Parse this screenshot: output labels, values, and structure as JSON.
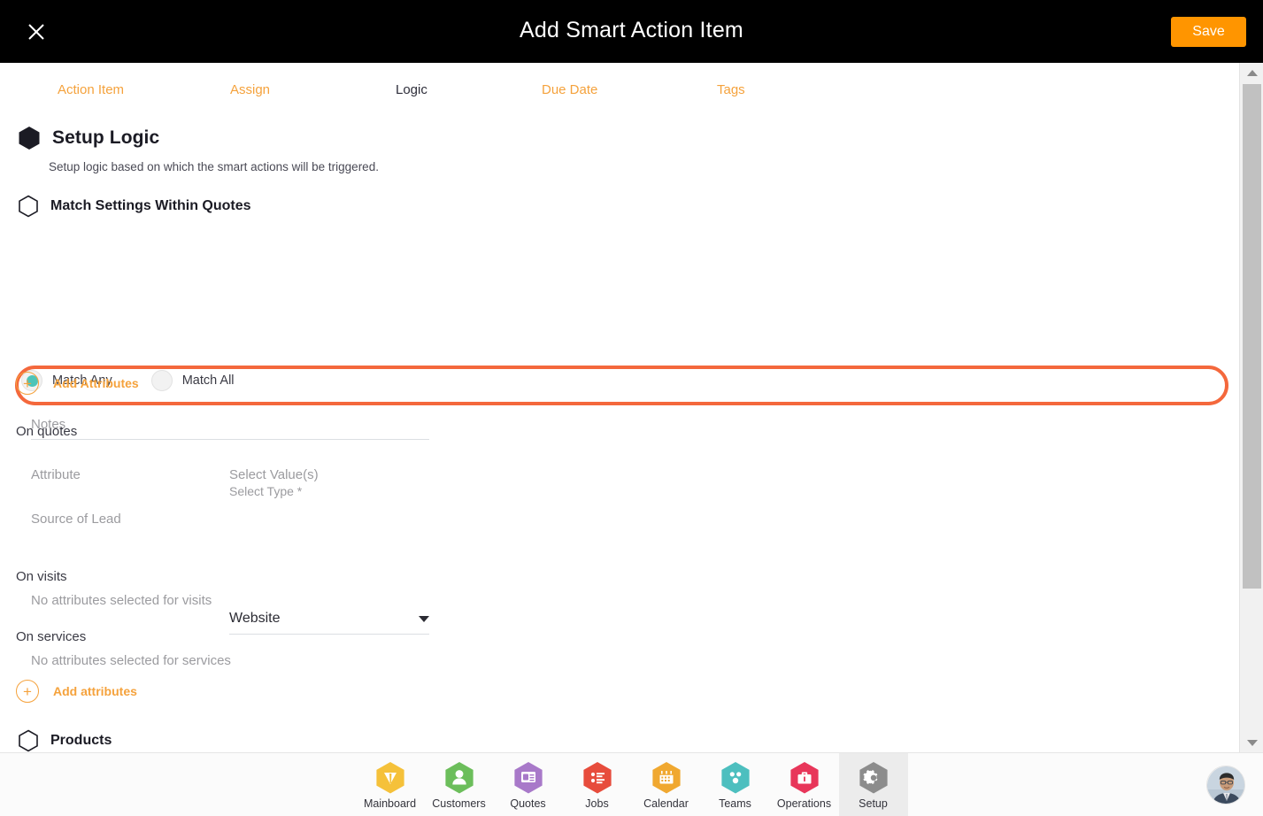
{
  "header": {
    "title": "Add Smart Action Item",
    "close_icon": "close-icon",
    "save_label": "Save"
  },
  "tabs": [
    {
      "label": "Action Item",
      "active": false
    },
    {
      "label": "Assign",
      "active": false
    },
    {
      "label": "Logic",
      "active": true
    },
    {
      "label": "Due Date",
      "active": false
    },
    {
      "label": "Tags",
      "active": false
    }
  ],
  "setup_logic": {
    "heading": "Setup Logic",
    "description": "Setup logic based on which the smart actions will be triggered.",
    "match_settings_heading": "Match Settings Within Quotes",
    "match_options": [
      {
        "label": "Match Any",
        "selected": true
      },
      {
        "label": "Match All",
        "selected": false
      }
    ],
    "notes_placeholder": "Notes",
    "notes_value": "",
    "add_attributes_label": "Add Attributes",
    "on_quotes": {
      "group_label": "On quotes",
      "col_attribute_label": "Attribute",
      "col_value_label": "Select Value(s)",
      "select_type_label": "Select Type *",
      "attribute_name": "Source of Lead",
      "selected_value": "Website"
    },
    "on_visits": {
      "group_label": "On visits",
      "empty_text": "No attributes selected for visits"
    },
    "on_services": {
      "group_label": "On services",
      "empty_text": "No attributes selected for services",
      "add_label": "Add attributes"
    },
    "products_heading": "Products"
  },
  "bottom_nav": [
    {
      "label": "Mainboard",
      "icon": "mainboard-icon",
      "color": "#F5C13A",
      "active": false
    },
    {
      "label": "Customers",
      "icon": "customers-icon",
      "color": "#6CBE5B",
      "active": false
    },
    {
      "label": "Quotes",
      "icon": "quotes-icon",
      "color": "#A879C9",
      "active": false
    },
    {
      "label": "Jobs",
      "icon": "jobs-icon",
      "color": "#E74C3C",
      "active": false
    },
    {
      "label": "Calendar",
      "icon": "calendar-icon",
      "color": "#F0A830",
      "active": false
    },
    {
      "label": "Teams",
      "icon": "teams-icon",
      "color": "#4DBFBF",
      "active": false
    },
    {
      "label": "Operations",
      "icon": "operations-icon",
      "color": "#E8365A",
      "active": false
    },
    {
      "label": "Setup",
      "icon": "gear-icon",
      "color": "#8C8C8C",
      "active": true
    }
  ],
  "colors": {
    "accent_orange": "#F5A23C",
    "save_orange": "#FF9500",
    "highlight_border": "#F4683C",
    "radio_teal": "#4DC4B8",
    "header_black": "#000000"
  }
}
